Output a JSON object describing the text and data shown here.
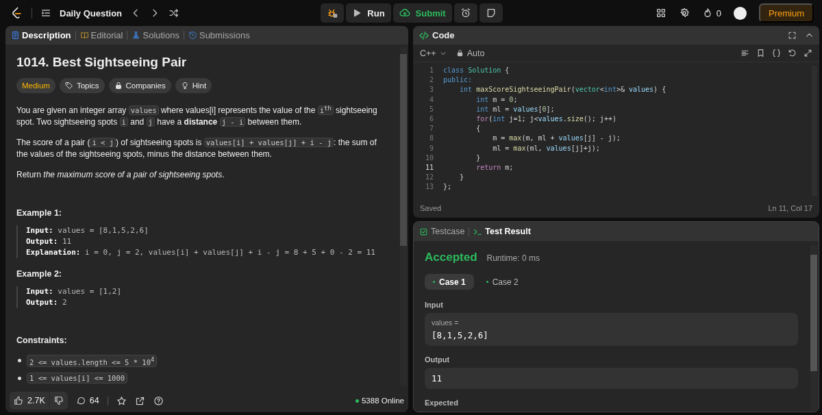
{
  "nav": {
    "title": "Daily Question"
  },
  "actions": [
    {
      "kind": "debug"
    },
    {
      "kind": "run",
      "label": "Run"
    },
    {
      "kind": "submit",
      "label": "Submit"
    },
    {
      "kind": "timer"
    },
    {
      "kind": "note"
    }
  ],
  "account": {
    "streak": "0",
    "premium": "Premium"
  },
  "description": {
    "tabs": [
      {
        "kind": "doc",
        "label": "Description",
        "selected": true
      },
      {
        "kind": "book",
        "label": "Editorial",
        "selected": false
      },
      {
        "kind": "flask",
        "label": "Solutions",
        "selected": false
      },
      {
        "kind": "history",
        "label": "Submissions",
        "selected": false
      }
    ],
    "title": "1014. Best Sightseeing Pair",
    "tags": [
      {
        "kind": "difficulty",
        "label": "Medium"
      },
      {
        "kind": "tag",
        "label": "Topics"
      },
      {
        "kind": "lock",
        "label": "Companies"
      },
      {
        "kind": "bulb",
        "label": "Hint"
      }
    ],
    "paragraphs": [
      [
        {
          "kind": "text",
          "text": "You are given an integer array "
        },
        {
          "kind": "code",
          "text": "values"
        },
        {
          "kind": "text",
          "text": " where values[i] represents the value of the "
        },
        {
          "kind": "code",
          "text": "i$^{th}$"
        },
        {
          "kind": "text",
          "text": " sightseeing spot. Two sightseeing spots "
        },
        {
          "kind": "code",
          "text": "i"
        },
        {
          "kind": "text",
          "text": " and "
        },
        {
          "kind": "code",
          "text": "j"
        },
        {
          "kind": "text",
          "text": " have a **distance** "
        },
        {
          "kind": "code",
          "text": "j - i"
        },
        {
          "kind": "text",
          "text": " between them."
        }
      ],
      [
        {
          "kind": "text",
          "text": "The score of a pair ("
        },
        {
          "kind": "code",
          "text": "i < j"
        },
        {
          "kind": "text",
          "text": ") of sightseeing spots is "
        },
        {
          "kind": "code",
          "text": "values[i] + values[j] + i - j"
        },
        {
          "kind": "text",
          "text": ": the sum of the values of the sightseeing spots, minus the distance between them."
        }
      ],
      [
        {
          "kind": "text",
          "text": "Return *the maximum score of a pair of sightseeing spots*."
        }
      ]
    ],
    "examples": [
      {
        "heading": "Example 1:",
        "lines": [
          {
            "label": "Input:",
            "value": "values = [8,1,5,2,6]"
          },
          {
            "label": "Output:",
            "value": "11"
          },
          {
            "label": "Explanation:",
            "value": "i = 0, j = 2, values[i] + values[j] + i - j = 8 + 5 + 0 - 2 = 11"
          }
        ]
      },
      {
        "heading": "Example 2:",
        "lines": [
          {
            "label": "Input:",
            "value": "values = [1,2]"
          },
          {
            "label": "Output:",
            "value": "2"
          }
        ]
      }
    ],
    "constraints_heading": "Constraints:",
    "constraints": [
      "2 <= values.length <= 5 * 10$^{4}$",
      "1 <= values[i] <= 1000"
    ],
    "footer": {
      "likes": "2.7K",
      "comments": "64",
      "online": "5388 Online"
    }
  },
  "code": {
    "title": "Code",
    "language": "C++",
    "mode": "Auto",
    "lines": [
      {
        "number": "1",
        "current": false,
        "tokens": [
          {
            "kind": "kw",
            "text": "class "
          },
          {
            "kind": "type",
            "text": "Solution"
          },
          {
            "kind": "plain",
            "text": " {"
          }
        ]
      },
      {
        "number": "2",
        "current": false,
        "tokens": [
          {
            "kind": "kw",
            "text": "public:"
          }
        ]
      },
      {
        "number": "3",
        "current": false,
        "tokens": [
          {
            "kind": "kw",
            "text": "    int "
          },
          {
            "kind": "fn",
            "text": "maxScoreSightseeingPair"
          },
          {
            "kind": "plain",
            "text": "("
          },
          {
            "kind": "type",
            "text": "vector"
          },
          {
            "kind": "plain",
            "text": "<"
          },
          {
            "kind": "kw",
            "text": "int"
          },
          {
            "kind": "plain",
            "text": ">& "
          },
          {
            "kind": "var",
            "text": "values"
          },
          {
            "kind": "plain",
            "text": ") {"
          }
        ]
      },
      {
        "number": "4",
        "current": false,
        "tokens": [
          {
            "kind": "kw",
            "text": "        int "
          },
          {
            "kind": "plain",
            "text": "m = "
          },
          {
            "kind": "num",
            "text": "0"
          },
          {
            "kind": "plain",
            "text": ";"
          }
        ]
      },
      {
        "number": "5",
        "current": false,
        "tokens": [
          {
            "kind": "kw",
            "text": "        int "
          },
          {
            "kind": "plain",
            "text": "ml = "
          },
          {
            "kind": "var",
            "text": "values"
          },
          {
            "kind": "plain",
            "text": "["
          },
          {
            "kind": "num",
            "text": "0"
          },
          {
            "kind": "plain",
            "text": "];"
          }
        ]
      },
      {
        "number": "6",
        "current": false,
        "tokens": [
          {
            "kind": "ctl",
            "text": "        for"
          },
          {
            "kind": "plain",
            "text": "("
          },
          {
            "kind": "kw",
            "text": "int "
          },
          {
            "kind": "plain",
            "text": "j="
          },
          {
            "kind": "num",
            "text": "1"
          },
          {
            "kind": "plain",
            "text": "; j<"
          },
          {
            "kind": "var",
            "text": "values"
          },
          {
            "kind": "plain",
            "text": "."
          },
          {
            "kind": "fn",
            "text": "size"
          },
          {
            "kind": "plain",
            "text": "(); j++)"
          }
        ]
      },
      {
        "number": "7",
        "current": false,
        "tokens": [
          {
            "kind": "plain",
            "text": "        {"
          }
        ]
      },
      {
        "number": "8",
        "current": false,
        "tokens": [
          {
            "kind": "plain",
            "text": "            m = "
          },
          {
            "kind": "fn",
            "text": "max"
          },
          {
            "kind": "plain",
            "text": "(m, ml + "
          },
          {
            "kind": "var",
            "text": "values"
          },
          {
            "kind": "plain",
            "text": "[j] - j);"
          }
        ]
      },
      {
        "number": "9",
        "current": false,
        "tokens": [
          {
            "kind": "plain",
            "text": "            ml = "
          },
          {
            "kind": "fn",
            "text": "max"
          },
          {
            "kind": "plain",
            "text": "(ml, "
          },
          {
            "kind": "var",
            "text": "values"
          },
          {
            "kind": "plain",
            "text": "[j]+j);"
          }
        ]
      },
      {
        "number": "10",
        "current": false,
        "tokens": [
          {
            "kind": "plain",
            "text": "        }"
          }
        ]
      },
      {
        "number": "11",
        "current": true,
        "tokens": [
          {
            "kind": "ctl",
            "text": "        return "
          },
          {
            "kind": "plain",
            "text": "m;"
          }
        ]
      },
      {
        "number": "12",
        "current": false,
        "tokens": [
          {
            "kind": "plain",
            "text": "    }"
          }
        ]
      },
      {
        "number": "13",
        "current": false,
        "tokens": [
          {
            "kind": "plain",
            "text": "};"
          }
        ]
      }
    ],
    "status": "Saved",
    "cursor": "Ln 11, Col 17"
  },
  "result": {
    "tabs": [
      {
        "kind": "check",
        "label": "Testcase",
        "selected": false
      },
      {
        "kind": "terminal",
        "label": "Test Result",
        "selected": true
      }
    ],
    "verdict": "Accepted",
    "runtime": "Runtime: 0 ms",
    "cases": [
      {
        "label": "Case 1",
        "selected": true
      },
      {
        "label": "Case 2",
        "selected": false
      }
    ],
    "sections": [
      {
        "label": "Input",
        "boxes": [
          {
            "name": "values =",
            "value": "[8,1,5,2,6]"
          }
        ]
      },
      {
        "label": "Output",
        "boxes": [
          {
            "value": "11"
          }
        ]
      },
      {
        "label": "Expected"
      }
    ]
  }
}
